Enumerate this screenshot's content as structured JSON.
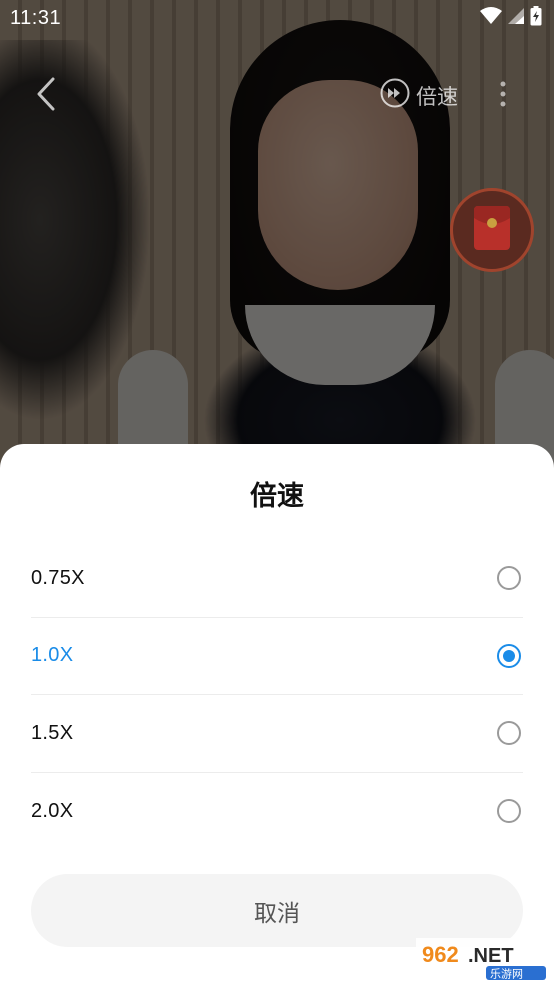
{
  "status_bar": {
    "time": "11:31"
  },
  "player": {
    "speed_label": "倍速"
  },
  "sheet": {
    "title": "倍速",
    "options": [
      {
        "label": "0.75X",
        "selected": false
      },
      {
        "label": "1.0X",
        "selected": true
      },
      {
        "label": "1.5X",
        "selected": false
      },
      {
        "label": "2.0X",
        "selected": false
      }
    ],
    "cancel_label": "取消"
  },
  "watermark": {
    "brand": "962.NET",
    "sub": "乐游网"
  },
  "colors": {
    "accent": "#1a8ce8",
    "red_packet": "#c8332a"
  }
}
